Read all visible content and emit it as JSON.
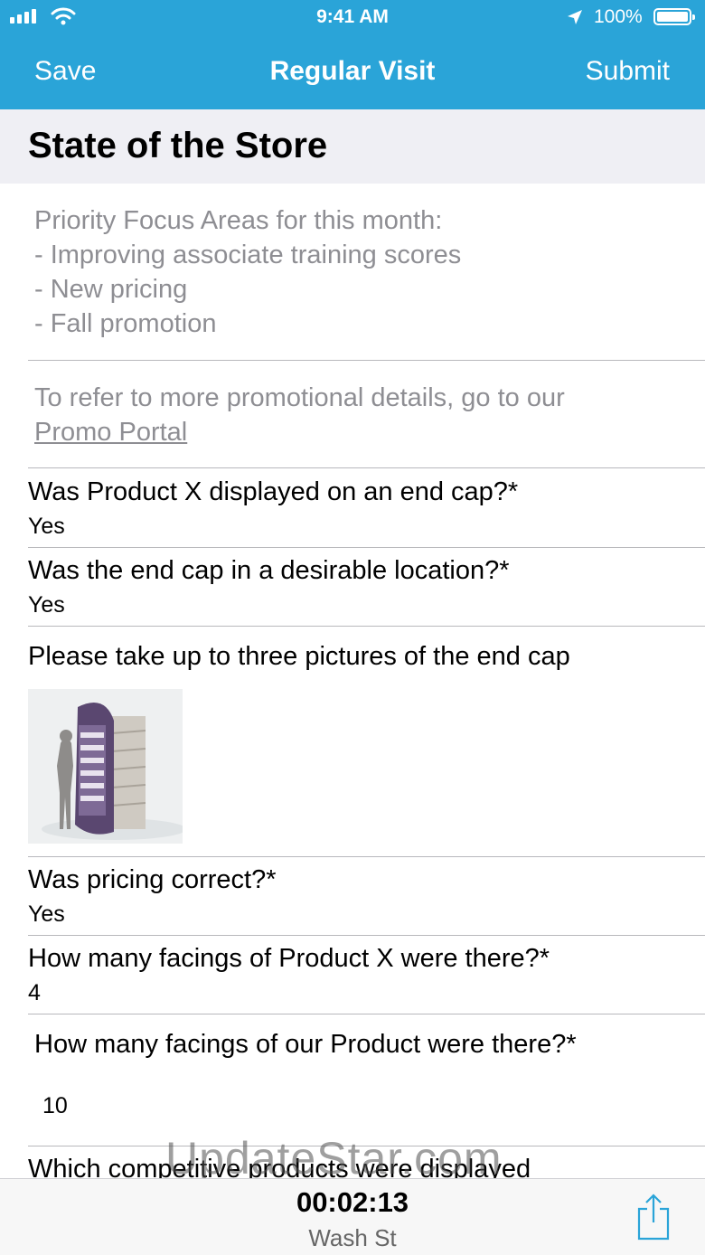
{
  "status_bar": {
    "time": "9:41 AM",
    "battery": "100%"
  },
  "nav": {
    "save_label": "Save",
    "title": "Regular Visit",
    "submit_label": "Submit"
  },
  "section": {
    "title": "State of the Store"
  },
  "info": {
    "lines": [
      "Priority Focus Areas for this month:",
      "- Improving associate training scores",
      "- New pricing",
      "- Fall promotion"
    ],
    "promo_text": "To refer to more promotional details, go to our",
    "promo_link": "Promo Portal"
  },
  "questions": [
    {
      "label": "Was Product X displayed on an end cap?*",
      "answer": "Yes"
    },
    {
      "label": "Was the end cap in a desirable location?*",
      "answer": "Yes"
    },
    {
      "label": "Please take up to three pictures of the end cap",
      "answer": ""
    },
    {
      "label": "Was pricing correct?*",
      "answer": "Yes"
    },
    {
      "label": "How many facings of Product X were there?*",
      "answer": "4"
    },
    {
      "label": "How many facings of our Product were there?*",
      "answer": "10"
    },
    {
      "label": "Which competitive products were displayed",
      "answer": ""
    }
  ],
  "watermark": "UpdateStar.com",
  "footer": {
    "timer": "00:02:13",
    "store": "Wash St"
  },
  "colors": {
    "nav_bg": "#2aa4d8",
    "section_bg": "#efeff4",
    "info_text": "#8e8e93"
  }
}
